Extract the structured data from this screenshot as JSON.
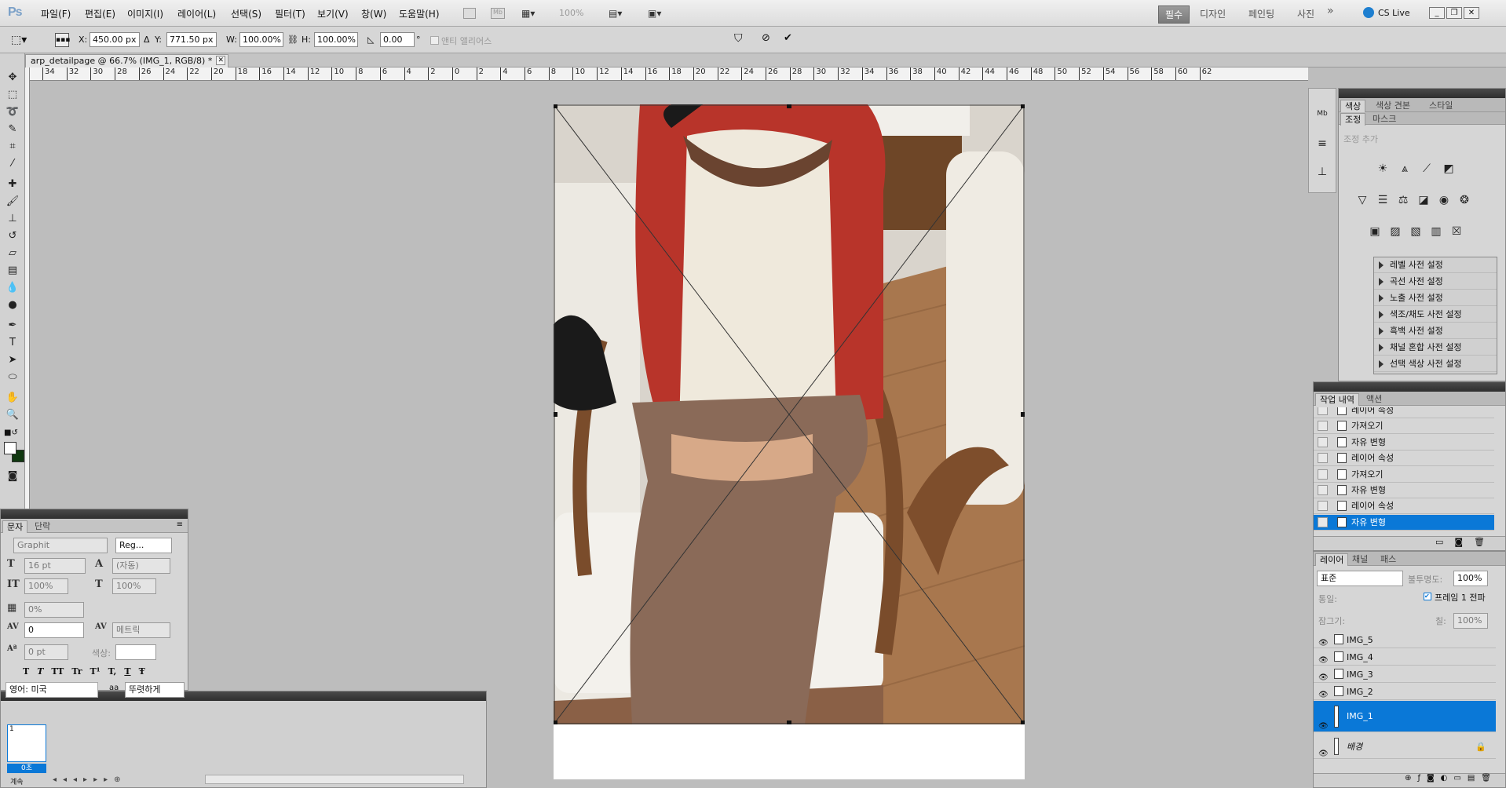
{
  "app": {
    "logo": "Ps"
  },
  "menu": [
    "파일(F)",
    "편집(E)",
    "이미지(I)",
    "레이어(L)",
    "선택(S)",
    "필터(T)",
    "보기(V)",
    "창(W)",
    "도움말(H)"
  ],
  "zoom_display": "100%",
  "workspaces": [
    "필수",
    "디자인",
    "페인팅",
    "사진"
  ],
  "workspace_more": "»",
  "cslive": "CS Live",
  "options": {
    "x_label": "X:",
    "x_value": "450.00 px",
    "y_label": "Y:",
    "y_value": "771.50 px",
    "w_label": "W:",
    "w_value": "100.00%",
    "h_label": "H:",
    "h_value": "100.00%",
    "angle_value": "0.00",
    "angle_unit": "°",
    "antialias": "앤티 앨리어스"
  },
  "doc_tab": {
    "title": "arp_detailpage @ 66.7% (IMG_1, RGB/8) *"
  },
  "ruler_labels": [
    "34",
    "32",
    "30",
    "28",
    "26",
    "24",
    "22",
    "20",
    "18",
    "16",
    "14",
    "12",
    "10",
    "8",
    "6",
    "4",
    "2",
    "0",
    "2",
    "4",
    "6",
    "8",
    "10",
    "12",
    "14",
    "16",
    "18",
    "20",
    "22",
    "24",
    "26",
    "28",
    "30",
    "32",
    "34",
    "36",
    "38",
    "40",
    "42",
    "44",
    "46",
    "48",
    "50",
    "52",
    "54",
    "56",
    "58",
    "60",
    "62"
  ],
  "char_panel": {
    "tabs": [
      "문자",
      "단락"
    ],
    "font_family": "Graphit",
    "font_style": "Reg...",
    "size": "16 pt",
    "leading": "(자동)",
    "v_scale": "100%",
    "h_scale": "100%",
    "tsume": "0%",
    "tracking": "0",
    "kerning": "메트릭",
    "baseline": "0 pt",
    "color_label": "색상:",
    "styles": [
      "T",
      "T",
      "TT",
      "Tr",
      "T¹",
      "T,",
      "T",
      "Ŧ"
    ],
    "language": "영어: 미국",
    "aa_label": "aa",
    "antialias": "뚜렷하게"
  },
  "anim_panel": {
    "frame_number": "1",
    "frame_time": "0초",
    "loop": "계속"
  },
  "right_panels": {
    "color_tabs": [
      "색상",
      "색상 견본",
      "스타일"
    ],
    "adj_tabs": [
      "조정",
      "마스크"
    ],
    "adj_header": "조정 추가",
    "presets": [
      "레벨 사전 설정",
      "곡선 사전 설정",
      "노출 사전 설정",
      "색조/채도 사전 설정",
      "흑백 사전 설정",
      "채널 혼합 사전 설정",
      "선택 색상 사전 설정"
    ],
    "history_tabs": [
      "작업 내역",
      "액션"
    ],
    "history": [
      "레이어 속성",
      "가져오기",
      "자유 변형",
      "레이어 속성",
      "가져오기",
      "자유 변형",
      "레이어 속성",
      "자유 변형"
    ],
    "history_selected": 7,
    "layer_tabs": [
      "레이어",
      "채널",
      "패스"
    ],
    "blend_mode": "표준",
    "opacity_label": "불투명도:",
    "opacity": "100%",
    "unify_label": "통일:",
    "frame1_label": "프레임 1 전파",
    "lock_label": "잠그기:",
    "fill_label": "칠:",
    "fill": "100%",
    "layers": [
      "IMG_5",
      "IMG_4",
      "IMG_3",
      "IMG_2",
      "IMG_1",
      "배경"
    ],
    "layer_selected": 4
  },
  "colors": {
    "accent": "#0a78d7",
    "shirt_red": "#b8342a",
    "pants_brown": "#8a6a58",
    "floor": "#a8774e"
  }
}
